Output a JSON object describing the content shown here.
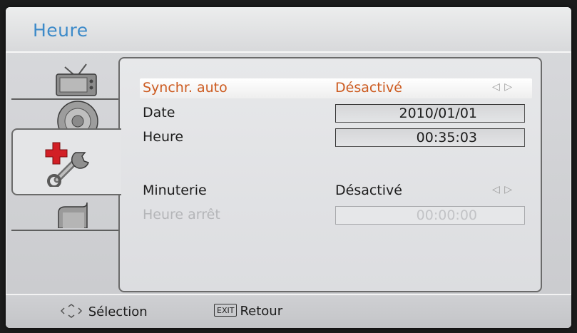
{
  "header": {
    "title": "Heure"
  },
  "tabs": [
    {
      "icon": "tv-icon"
    },
    {
      "icon": "speaker-icon"
    },
    {
      "icon": "tools-icon",
      "selected": true
    },
    {
      "icon": "lock-icon"
    }
  ],
  "settings": {
    "sync": {
      "label": "Synchr. auto",
      "value": "Désactivé",
      "arrows": "◁ ▷"
    },
    "date": {
      "label": "Date",
      "value": "2010/01/01"
    },
    "time": {
      "label": "Heure",
      "value": "00:35:03"
    },
    "timer": {
      "label": "Minuterie",
      "value": "Désactivé",
      "arrows": "◁ ▷"
    },
    "stop_time": {
      "label": "Heure arrêt",
      "value": "00:00:00"
    }
  },
  "footer": {
    "select_label": "Sélection",
    "exit_key": "EXIT",
    "back_label": "Retour"
  },
  "colors": {
    "title": "#3c8ac9",
    "highlight_text": "#cc5a1f"
  }
}
